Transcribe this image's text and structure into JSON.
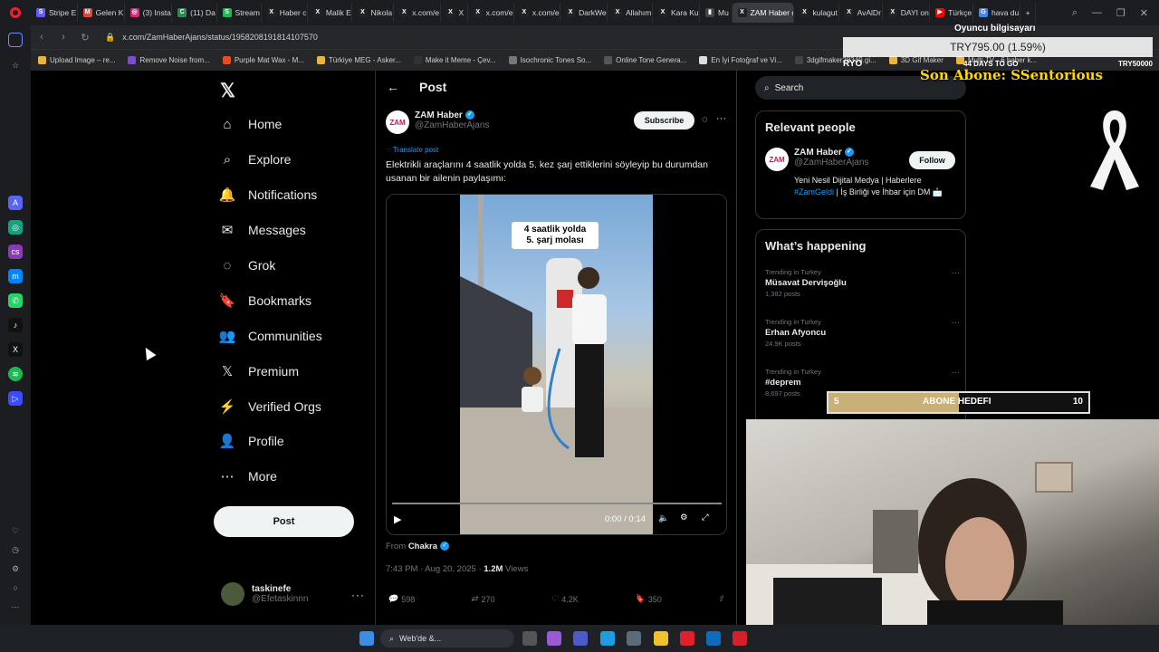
{
  "browser": {
    "tabs": [
      {
        "label": "Stripe E",
        "color": "#635bff",
        "glyph": "S"
      },
      {
        "label": "Gelen K",
        "color": "#ea4335",
        "glyph": "M"
      },
      {
        "label": "(3) Insta",
        "color": "#d62976",
        "glyph": "◎"
      },
      {
        "label": "(11) Da",
        "color": "#2b8a5a",
        "glyph": "C"
      },
      {
        "label": "Stream",
        "color": "#1db954",
        "glyph": "S"
      },
      {
        "label": "Haber c",
        "color": "#222",
        "glyph": "X"
      },
      {
        "label": "Malik E",
        "color": "#222",
        "glyph": "X"
      },
      {
        "label": "Nikola",
        "color": "#222",
        "glyph": "X"
      },
      {
        "label": "x.com/e",
        "color": "#222",
        "glyph": "X"
      },
      {
        "label": "X",
        "color": "#222",
        "glyph": "X"
      },
      {
        "label": "x.com/e",
        "color": "#222",
        "glyph": "X"
      },
      {
        "label": "x.com/e",
        "color": "#222",
        "glyph": "X"
      },
      {
        "label": "DarkWe",
        "color": "#222",
        "glyph": "X"
      },
      {
        "label": "Allahım",
        "color": "#222",
        "glyph": "X"
      },
      {
        "label": "Kara Ku",
        "color": "#222",
        "glyph": "X"
      },
      {
        "label": "Mu",
        "color": "#444",
        "glyph": "▮"
      },
      {
        "label": "ZAM Haber c",
        "color": "#222",
        "glyph": "X",
        "active": true
      },
      {
        "label": "kulagut",
        "color": "#222",
        "glyph": "X"
      },
      {
        "label": "AvAlDr",
        "color": "#222",
        "glyph": "X"
      },
      {
        "label": "DAYI on",
        "color": "#222",
        "glyph": "X"
      },
      {
        "label": "Türkçe",
        "color": "#ff0000",
        "glyph": "▶"
      },
      {
        "label": "hava du",
        "color": "#4285f4",
        "glyph": "G"
      }
    ],
    "url": "x.com/ZamHaberAjans/status/1958208191814107570",
    "bookmarks": [
      {
        "label": "Upload Image – re...",
        "color": "#e8b63e"
      },
      {
        "label": "Remove Noise from...",
        "color": "#7b4bd6"
      },
      {
        "label": "Purple Mat Wax - M...",
        "color": "#e44d26"
      },
      {
        "label": "Türkiye MEG - Asker...",
        "color": "#e8b63e"
      },
      {
        "label": "Make it Meme - Çev...",
        "color": "#333"
      },
      {
        "label": "Isochronic Tones So...",
        "color": "#777"
      },
      {
        "label": "Online Tone Genera...",
        "color": "#555"
      },
      {
        "label": "En İyi Fotoğraf ve Vi...",
        "color": "#ddd"
      },
      {
        "label": "3dgifmaker28349.gi...",
        "color": "#444"
      },
      {
        "label": "3D Gif Maker",
        "color": "#e8b63e"
      },
      {
        "label": "Multi TV - 6 haber k...",
        "color": "#e8b63e"
      }
    ]
  },
  "x": {
    "nav": [
      {
        "label": "Home",
        "icon": "⌂",
        "name": "home"
      },
      {
        "label": "Explore",
        "icon": "⌕",
        "name": "explore"
      },
      {
        "label": "Notifications",
        "icon": "🔔",
        "name": "notifications"
      },
      {
        "label": "Messages",
        "icon": "✉",
        "name": "messages"
      },
      {
        "label": "Grok",
        "icon": "◌",
        "name": "grok"
      },
      {
        "label": "Bookmarks",
        "icon": "🔖",
        "name": "bookmarks"
      },
      {
        "label": "Communities",
        "icon": "👥",
        "name": "communities"
      },
      {
        "label": "Premium",
        "icon": "𝕏",
        "name": "premium"
      },
      {
        "label": "Verified Orgs",
        "icon": "⚡",
        "name": "verified-orgs"
      },
      {
        "label": "Profile",
        "icon": "👤",
        "name": "profile"
      },
      {
        "label": "More",
        "icon": "⋯",
        "name": "more"
      }
    ],
    "post_button": "Post",
    "account": {
      "name": "taskinefe",
      "handle": "@Efetaskinnn"
    },
    "post": {
      "header": "Post",
      "author_name": "ZAM Haber",
      "author_handle": "@ZamHaberAjans",
      "avatar_text": "ZAM",
      "subscribe": "Subscribe",
      "translate": "Translate post",
      "text": "Elektrikli araçlarını 4 saatlik yolda 5. kez şarj ettiklerini söyleyip bu durumdan usanan bir ailenin paylaşımı:",
      "video_caption_1": "4 saatlik yolda",
      "video_caption_2": "5. şarj molası",
      "video_time": "0:00 / 0:14",
      "from_label": "From",
      "from_source": "Chakra",
      "timestamp": "7:43 PM · Aug 20, 2025 ·",
      "views": "1.2M",
      "views_label": "Views",
      "replies": "598",
      "reposts": "270",
      "likes": "4.2K",
      "bookmarks": "350"
    },
    "search_placeholder": "Search",
    "relevant": {
      "title": "Relevant people",
      "name": "ZAM Haber",
      "handle": "@ZamHaberAjans",
      "follow": "Follow",
      "bio_1": "Yeni Nesil Dijital Medya | Haberlere",
      "bio_tag": "#ZamGeldi",
      "bio_2": "| İş Birliği ve İhbar için DM"
    },
    "happening": {
      "title": "What’s happening",
      "trends": [
        {
          "context": "Trending in Turkey",
          "topic": "Müsavat Dervişoğlu",
          "count": "1,382 posts"
        },
        {
          "context": "Trending in Turkey",
          "topic": "Erhan Afyoncu",
          "count": "24.9K posts"
        },
        {
          "context": "Trending in Turkey",
          "topic": "#deprem",
          "count": "8,697 posts"
        }
      ]
    }
  },
  "overlay": {
    "gaming_pc": "Oyuncu bilgisayarı",
    "price": "TRY795.00 (1.59%)",
    "ryo": "RYO",
    "days": "44 DAYS TO GO",
    "try_right": "TRY50000",
    "son_abone": "Son Abone: SSentorious",
    "goal_left": "5",
    "goal_label": "ABONE HEDEFI",
    "goal_right": "10",
    "goal_fraction": 0.5
  },
  "taskbar": {
    "search_text": "Web'de &..."
  }
}
